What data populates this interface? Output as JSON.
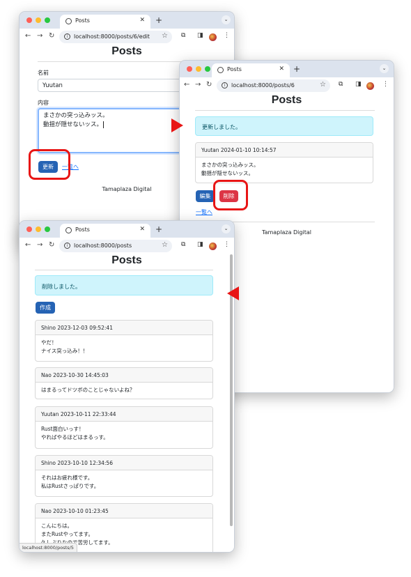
{
  "edit_window": {
    "tab_title": "Posts",
    "url": "localhost:8000/posts/6/edit",
    "heading": "Posts",
    "name_label": "名前",
    "name_value": "Yuutan",
    "content_label": "内容",
    "content_lines": [
      "まさかの突っ込みッス。",
      "動揺が隠せないッス。"
    ],
    "update_button": "更新",
    "list_link": "一覧へ",
    "footer": "Tamaplaza Digital"
  },
  "show_window": {
    "tab_title": "Posts",
    "url": "localhost:8000/posts/6",
    "heading": "Posts",
    "alert": "更新しました。",
    "post_header": "Yuutan 2024-01-10 10:14:57",
    "post_lines": [
      "まさかの突っ込みッス。",
      "動揺が隠せないッス。"
    ],
    "edit_button": "編集",
    "delete_button": "削除",
    "list_link": "一覧へ",
    "footer": "Tamaplaza Digital"
  },
  "index_window": {
    "tab_title": "Posts",
    "url": "localhost:8000/posts",
    "heading": "Posts",
    "alert": "削除しました。",
    "create_button": "作成",
    "posts": [
      {
        "header": "Shino 2023-12-03 09:52:41",
        "lines": [
          "やだ！",
          "ナイス突っ込み！！"
        ]
      },
      {
        "header": "Nao 2023-10-30 14:45:03",
        "lines": [
          "はまるってドツボのことじゃないよね？"
        ]
      },
      {
        "header": "Yuutan 2023-10-11 22:33:44",
        "lines": [
          "Rust面白いっす！",
          "やればやるほどはまるっす。"
        ]
      },
      {
        "header": "Shino 2023-10-10 12:34:56",
        "lines": [
          "それはお疲れ様です。",
          "私はRustさっぱりです。"
        ]
      },
      {
        "header": "Nao 2023-10-10 01:23:45",
        "lines": [
          "こんにちは。",
          "またRustやってます。",
          "久しぶりなので苦労してます。"
        ]
      }
    ],
    "status_url": "localhost:8000/posts/5"
  },
  "colors": {
    "primary": "#2563b4",
    "danger": "#dc3545",
    "alert_bg": "#cff4fc",
    "callout": "#e81515",
    "tab_strip": "#dce3ee"
  },
  "icons": [
    "back-arrow-icon",
    "forward-arrow-icon",
    "reload-icon",
    "site-info-icon",
    "bookmark-star-icon",
    "extensions-icon",
    "sidepanel-icon",
    "profile-avatar-icon",
    "kebab-menu-icon",
    "globe-icon",
    "close-icon"
  ]
}
